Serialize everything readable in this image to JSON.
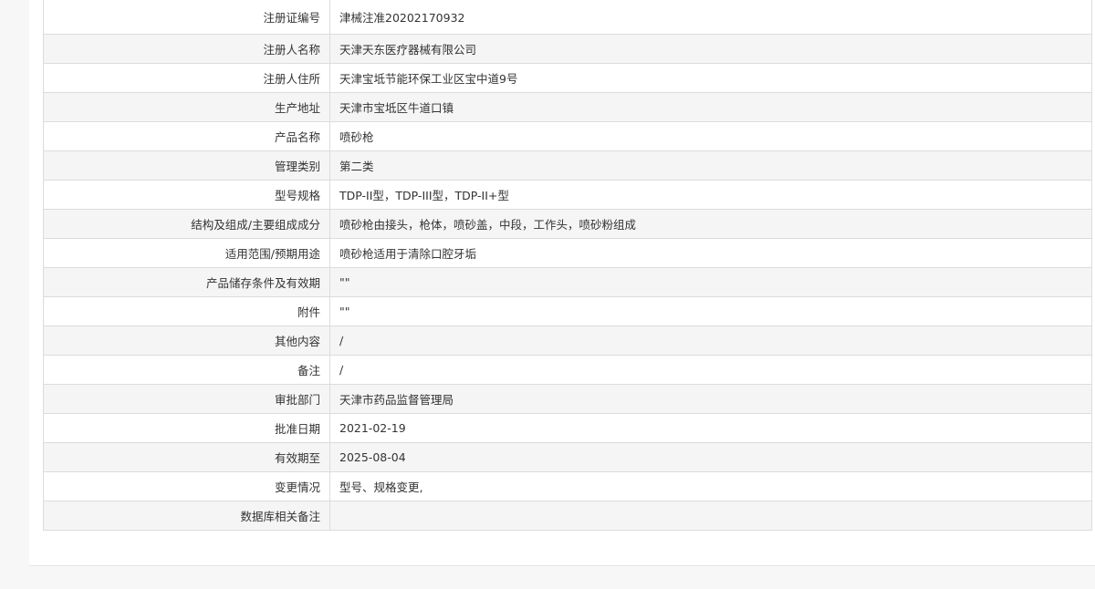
{
  "detail": {
    "rows": [
      {
        "label": "注册证编号",
        "value": "津械注准20202170932"
      },
      {
        "label": "注册人名称",
        "value": "天津天东医疗器械有限公司"
      },
      {
        "label": "注册人住所",
        "value": "天津宝坻节能环保工业区宝中道9号"
      },
      {
        "label": "生产地址",
        "value": "天津市宝坻区牛道口镇"
      },
      {
        "label": "产品名称",
        "value": "喷砂枪"
      },
      {
        "label": "管理类别",
        "value": "第二类"
      },
      {
        "label": "型号规格",
        "value": "TDP-II型，TDP-III型，TDP-II+型"
      },
      {
        "label": "结构及组成/主要组成成分",
        "value": "喷砂枪由接头，枪体，喷砂盖，中段，工作头，喷砂粉组成"
      },
      {
        "label": "适用范围/预期用途",
        "value": "喷砂枪适用于清除口腔牙垢"
      },
      {
        "label": "产品储存条件及有效期",
        "value": "\"\""
      },
      {
        "label": "附件",
        "value": "\"\""
      },
      {
        "label": "其他内容",
        "value": "/"
      },
      {
        "label": "备注",
        "value": "/"
      },
      {
        "label": "审批部门",
        "value": "天津市药品监督管理局"
      },
      {
        "label": "批准日期",
        "value": "2021-02-19"
      },
      {
        "label": "有效期至",
        "value": "2025-08-04"
      },
      {
        "label": "变更情况",
        "value": "型号、规格变更,"
      },
      {
        "label": "数据库相关备注",
        "value": ""
      }
    ]
  }
}
